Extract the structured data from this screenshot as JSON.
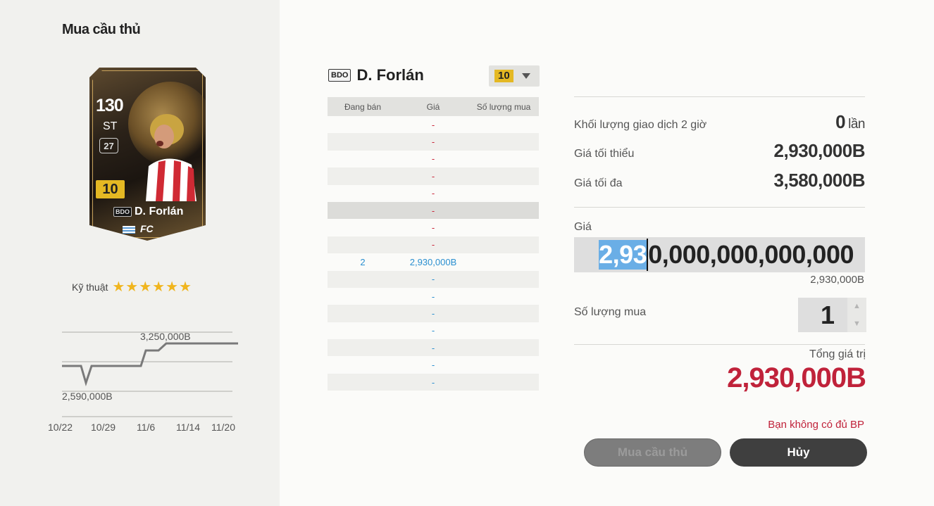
{
  "left_panel": {
    "title": "Mua cầu thủ",
    "card": {
      "ovr": "130",
      "position": "ST",
      "level": "27",
      "grade": "10",
      "season": "BDO",
      "name": "D. Forlán"
    },
    "skill_label": "Kỹ thuật",
    "skill_stars": "★★★★★★",
    "price_chart": {
      "high_label": "3,250,000B",
      "low_label": "2,590,000B",
      "dates": [
        "10/22",
        "10/29",
        "11/6",
        "11/14",
        "11/20"
      ]
    }
  },
  "header": {
    "season": "BDO",
    "player_name": "D. Forlán",
    "grade": "10"
  },
  "orders": {
    "columns": [
      "Đang bán",
      "Giá",
      "Số lượng mua"
    ],
    "sell_rows": [
      "-",
      "-",
      "-",
      "-",
      "-",
      "-",
      "-",
      "-"
    ],
    "mid_row": {
      "selling": "2",
      "price": "2,930,000B",
      "buy_qty": ""
    },
    "buy_rows": [
      "-",
      "-",
      "-",
      "-",
      "-",
      "-",
      "-"
    ]
  },
  "stats": {
    "volume_label": "Khối lượng giao dịch 2 giờ",
    "volume_value": "0",
    "volume_unit": "lần",
    "min_label": "Giá tối thiểu",
    "min_value": "2,930,000B",
    "max_label": "Giá tối đa",
    "max_value": "3,580,000B"
  },
  "price": {
    "label": "Giá",
    "input_selected": "2,93",
    "input_rest": "0,000,000,000,000",
    "sub_value": "2,930,000B"
  },
  "quantity": {
    "label": "Số lượng mua",
    "value": "1",
    "up_arrow": "▲",
    "down_arrow": "▼"
  },
  "total": {
    "label": "Tổng giá trị",
    "value": "2,930,000B"
  },
  "warning": "Bạn không có đủ BP",
  "buttons": {
    "buy": "Mua cầu thủ",
    "cancel": "Hủy"
  },
  "colors": {
    "accent_red": "#c0223a",
    "grade_gold": "#e4b823",
    "buy_blue": "#2a8fd0",
    "star": "#f0b51e"
  }
}
